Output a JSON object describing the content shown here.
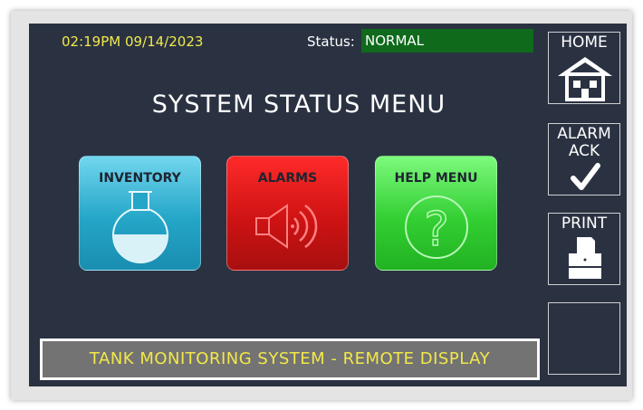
{
  "header": {
    "datetime": "02:19PM 09/14/2023",
    "status_label": "Status:",
    "status_value": "NORMAL"
  },
  "title": "SYSTEM STATUS MENU",
  "tiles": [
    {
      "label": "INVENTORY",
      "icon": "flask-icon",
      "color": "#24a6c8"
    },
    {
      "label": "ALARMS",
      "icon": "speaker-icon",
      "color": "#cf1313"
    },
    {
      "label": "HELP MENU",
      "icon": "question-icon",
      "color": "#33cf33"
    }
  ],
  "footer_text": "TANK MONITORING SYSTEM -  REMOTE DISPLAY",
  "side_buttons": {
    "home_label": "HOME",
    "alarm_ack_label_1": "ALARM",
    "alarm_ack_label_2": "ACK",
    "print_label": "PRINT"
  },
  "colors": {
    "screen_bg": "#2a3242",
    "accent_text": "#f2e84a",
    "status_ok": "#0f6a1c"
  }
}
